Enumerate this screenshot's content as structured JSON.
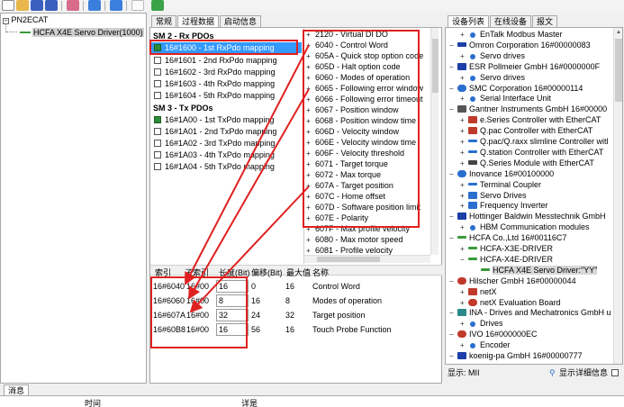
{
  "tree": {
    "root": "PN2ECAT",
    "child": "HCFA X4E Servo Driver(1000)"
  },
  "mid_tabs": [
    "常规",
    "过程数据",
    "启动信息"
  ],
  "sm2": {
    "title": "SM 2 - Rx PDOs",
    "items": [
      {
        "label": "16#1600 - 1st RxPdo mapping",
        "checked": true,
        "selected": true
      },
      {
        "label": "16#1601 - 2nd RxPdo mapping",
        "checked": false
      },
      {
        "label": "16#1602 - 3rd RxPdo mapping",
        "checked": false
      },
      {
        "label": "16#1603 - 4th RxPdo mapping",
        "checked": false
      },
      {
        "label": "16#1604 - 5th RxPdo mapping",
        "checked": false
      }
    ]
  },
  "sm3": {
    "title": "SM 3 - Tx PDOs",
    "items": [
      {
        "label": "16#1A00 - 1st TxPdo mapping",
        "checked": true
      },
      {
        "label": "16#1A01 - 2nd TxPdo mapping",
        "checked": false
      },
      {
        "label": "16#1A02 - 3rd TxPdo mapping",
        "checked": false
      },
      {
        "label": "16#1A03 - 4th TxPdo mapping",
        "checked": false
      },
      {
        "label": "16#1A04 - 5th TxPdo mapping",
        "checked": false
      }
    ]
  },
  "entries": [
    "2120 - Virtual DI DO",
    "6040 - Control Word",
    "605A - Quick stop option code",
    "605D - Halt option code",
    "6060 - Modes of operation",
    "6065 - Following error window",
    "6066 - Following error timeout",
    "6067 - Position window",
    "6068 - Position window time",
    "606D - Velocity window",
    "606E - Velocity window time",
    "606F - Velocity threshold",
    "6071 - Target torque",
    "6072 - Max torque",
    "607A - Target position",
    "607C - Home offset",
    "607D - Software position limit",
    "607E - Polarity",
    "607F - Max profile velocity",
    "6080 - Max motor speed",
    "6081 - Profile velocity"
  ],
  "mapping": {
    "headers": [
      "索引",
      "子索引",
      "长度(Bit)",
      "偏移(Bit)",
      "最大值",
      "名称"
    ],
    "rows": [
      {
        "index": "16#6040",
        "sub": "16#00",
        "len": "16",
        "offset": "0",
        "max": "16",
        "name": "Control Word"
      },
      {
        "index": "16#6060",
        "sub": "16#00",
        "len": "8",
        "offset": "16",
        "max": "8",
        "name": "Modes of operation"
      },
      {
        "index": "16#607A",
        "sub": "16#00",
        "len": "32",
        "offset": "24",
        "max": "32",
        "name": "Target position"
      },
      {
        "index": "16#60B8",
        "sub": "16#00",
        "len": "16",
        "offset": "56",
        "max": "16",
        "name": "Touch Probe Function"
      }
    ]
  },
  "right_tabs": [
    "设备列表",
    "在线设备",
    "报文"
  ],
  "devices": [
    {
      "text": "EnTalk Modbus Master",
      "x": 12,
      "sign": "+",
      "color": "#2a6fcf",
      "icon": "dot"
    },
    {
      "text": "Omron Corporation   16#00000083",
      "x": 0,
      "sign": "−",
      "color": "#1c3fa8",
      "icon": "bar"
    },
    {
      "text": "Servo drives",
      "x": 12,
      "sign": "+",
      "color": "#2a6fcf",
      "icon": "dot"
    },
    {
      "text": "ESR Pollmeier GmbH   16#0000000F",
      "x": 0,
      "sign": "−",
      "color": "#1c3fa8",
      "icon": "sq"
    },
    {
      "text": "Servo drives",
      "x": 12,
      "sign": "+",
      "color": "#2a6fcf",
      "icon": "dot"
    },
    {
      "text": "SMC Corporation   16#00000114",
      "x": 0,
      "sign": "−",
      "color": "#2a6fcf",
      "icon": "ball"
    },
    {
      "text": "Serial Interface Unit",
      "x": 12,
      "sign": "+",
      "color": "#2a6fcf",
      "icon": "dot"
    },
    {
      "text": "Gantner Instruments GmbH   16#00000",
      "x": 0,
      "sign": "−",
      "color": "#555",
      "icon": "sq"
    },
    {
      "text": "e.Series Controller with EtherCAT",
      "x": 12,
      "sign": "+",
      "color": "#c0392b",
      "icon": "sq"
    },
    {
      "text": "Q.pac Controller with EtherCAT",
      "x": 12,
      "sign": "+",
      "color": "#c0392b",
      "icon": "sq"
    },
    {
      "text": "Q.pac/Q.raxx slimline Controller witl",
      "x": 12,
      "sign": "+",
      "color": "#2a6fcf",
      "icon": "line"
    },
    {
      "text": "Q.station Controller with EtherCAT",
      "x": 12,
      "sign": "+",
      "color": "#2a6fcf",
      "icon": "line"
    },
    {
      "text": "Q.Series Module with EtherCAT",
      "x": 12,
      "sign": "+",
      "color": "#444",
      "icon": "bar"
    },
    {
      "text": "Inovance   16#00100000",
      "x": 0,
      "sign": "−",
      "color": "#2a6fcf",
      "icon": "ball"
    },
    {
      "text": "Terminal Coupler",
      "x": 12,
      "sign": "+",
      "color": "#2a6fcf",
      "icon": "line"
    },
    {
      "text": "Servo Drives",
      "x": 12,
      "sign": "+",
      "color": "#2a6fcf",
      "icon": "sq"
    },
    {
      "text": "Frequency Inverter",
      "x": 12,
      "sign": "+",
      "color": "#2a6fcf",
      "icon": "sq"
    },
    {
      "text": "Hottinger Baldwin Messtechnik GmbH",
      "x": 0,
      "sign": "−",
      "color": "#1c3fa8",
      "icon": "sq"
    },
    {
      "text": "HBM Communication modules",
      "x": 12,
      "sign": "+",
      "color": "#2a6fcf",
      "icon": "dot"
    },
    {
      "text": "HCFA Co.,Ltd   16#00116C7",
      "x": 0,
      "sign": "−",
      "color": "#3a9a3a",
      "icon": "line"
    },
    {
      "text": "HCFA-X3E-DRIVER",
      "x": 12,
      "sign": "+",
      "color": "#3a9a3a",
      "icon": "line"
    },
    {
      "text": "HCFA-X4E-DRIVER",
      "x": 12,
      "sign": "−",
      "color": "#3a9a3a",
      "icon": "line"
    },
    {
      "text": "HCFA X4E Servo Driver:\"YY\"",
      "x": 26,
      "sign": "",
      "color": "#3a9a3a",
      "icon": "line"
    },
    {
      "text": "Hilscher GmbH   16#00000044",
      "x": 0,
      "sign": "−",
      "color": "#c0392b",
      "icon": "ball"
    },
    {
      "text": "netX",
      "x": 12,
      "sign": "+",
      "color": "#c0392b",
      "icon": "sq"
    },
    {
      "text": "netX Evaluation Board",
      "x": 12,
      "sign": "+",
      "color": "#c0392b",
      "icon": "ball"
    },
    {
      "text": "INA - Drives and Mechatronics GmbH u",
      "x": 0,
      "sign": "−",
      "color": "#2a8a8a",
      "icon": "sq"
    },
    {
      "text": "Drives",
      "x": 12,
      "sign": "+",
      "color": "#2a6fcf",
      "icon": "dot"
    },
    {
      "text": "IVO   16#000000EC",
      "x": 0,
      "sign": "−",
      "color": "#c0392b",
      "icon": "ball"
    },
    {
      "text": "Encoder",
      "x": 12,
      "sign": "+",
      "color": "#2a6fcf",
      "icon": "dot"
    },
    {
      "text": "koenig-pa GmbH   16#00000777",
      "x": 0,
      "sign": "−",
      "color": "#1c3fa8",
      "icon": "sq"
    }
  ],
  "right_footer": {
    "show_label": "显示:",
    "show_value": "MII",
    "detail_label": "显示详细信息"
  },
  "messages": {
    "tab": "消息",
    "col_time": "时间",
    "col_detail": "详是"
  }
}
